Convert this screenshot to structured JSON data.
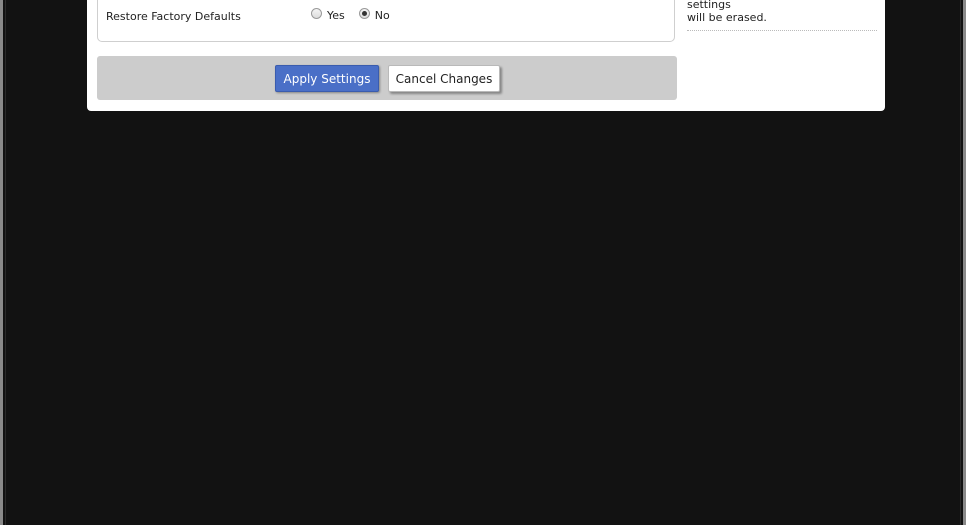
{
  "settings": {
    "restore_label": "Restore Factory Defaults",
    "options": [
      {
        "label": "Yes",
        "checked": false
      },
      {
        "label": "No",
        "checked": true
      }
    ]
  },
  "help": {
    "line1": "factory defaults. All of your settings",
    "line2": "will be erased."
  },
  "actions": {
    "apply_label": "Apply Settings",
    "cancel_label": "Cancel Changes"
  },
  "colors": {
    "background": "#121212",
    "apply_button": "#4a6fc7",
    "button_bar": "#cccccc"
  }
}
